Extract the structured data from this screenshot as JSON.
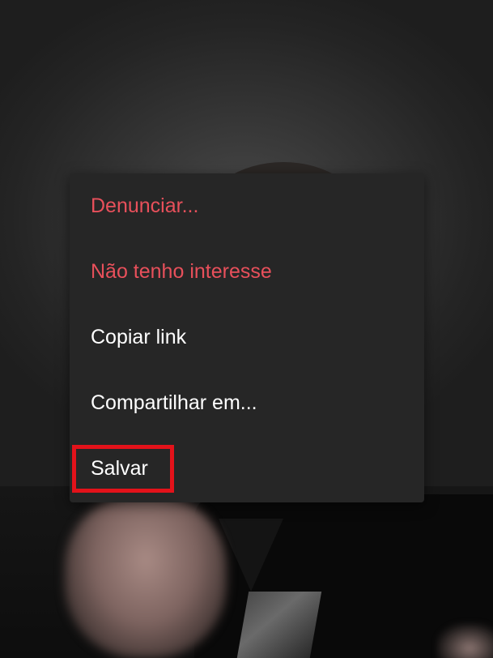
{
  "menu": {
    "items": [
      {
        "label": "Denunciar...",
        "color": "#e8505b"
      },
      {
        "label": "Não tenho interesse",
        "color": "#e8505b"
      },
      {
        "label": "Copiar link",
        "color": "#ffffff"
      },
      {
        "label": "Compartilhar em...",
        "color": "#ffffff"
      },
      {
        "label": "Salvar",
        "color": "#ffffff"
      }
    ],
    "background": "#262626"
  },
  "highlight": {
    "target": "Salvar",
    "color": "#e3121a"
  }
}
